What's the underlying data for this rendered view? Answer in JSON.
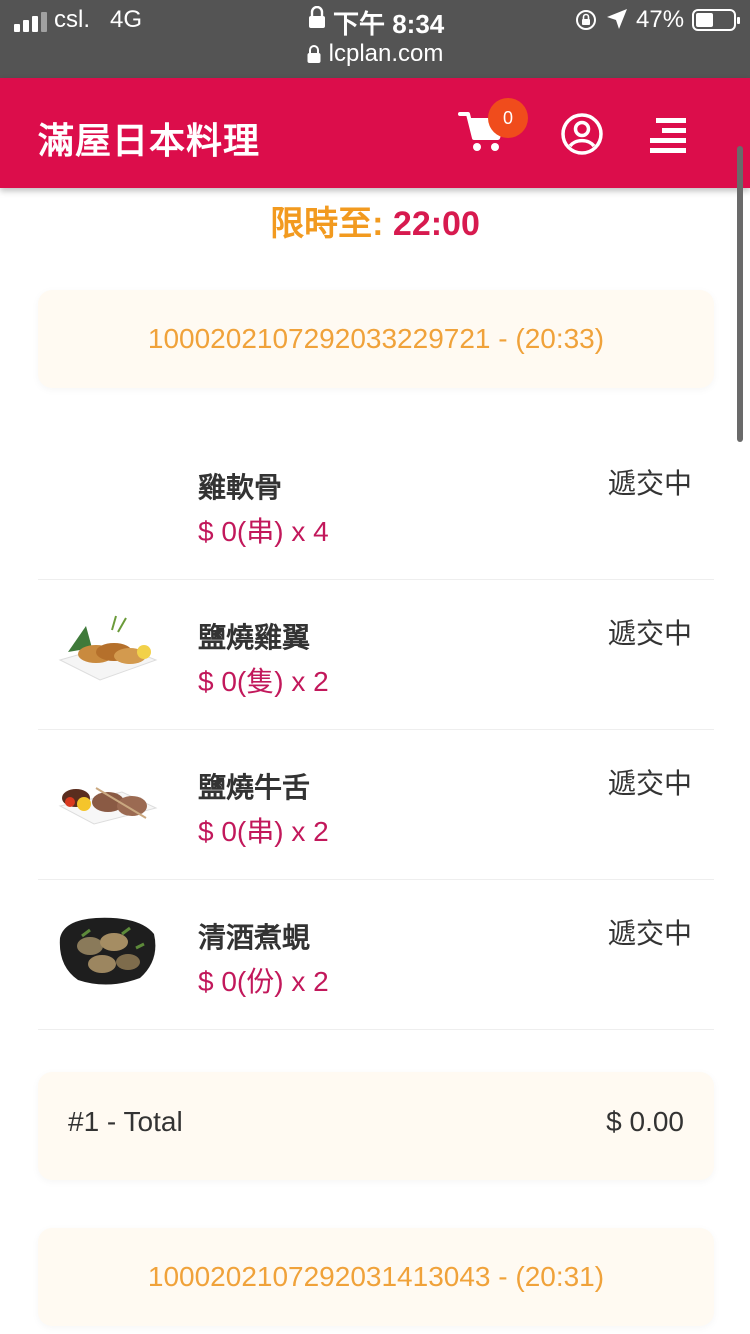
{
  "status_bar": {
    "carrier": "csl.",
    "network": "4G",
    "time": "下午 8:34",
    "battery_pct": "47%",
    "battery_level": 0.47
  },
  "browser": {
    "url": "lcplan.com"
  },
  "header": {
    "title": "滿屋日本料理",
    "cart_count": "0",
    "brand_color": "#dc0d4b"
  },
  "deadline": {
    "label": "限時至:",
    "time": "22:00"
  },
  "orders": [
    {
      "order_id_label": "100020210729203322972​1 - (20:33)",
      "items": [
        {
          "name": "雞軟骨",
          "price": "$ 0(串) x 4",
          "status": "遞交中",
          "image": "none"
        },
        {
          "name": "鹽燒雞翼",
          "price": "$ 0(隻) x 2",
          "status": "遞交中",
          "image": "grilled-wings-icon"
        },
        {
          "name": "鹽燒牛舌",
          "price": "$ 0(串) x 2",
          "status": "遞交中",
          "image": "beef-tongue-skewer-icon"
        },
        {
          "name": "清酒煮蜆",
          "price": "$ 0(份) x 2",
          "status": "遞交中",
          "image": "sake-clams-icon"
        }
      ],
      "total_label": "#1 - Total",
      "total_amount": "$ 0.00"
    },
    {
      "order_id_label": "1000202107292031413043 - (20:31)"
    }
  ]
}
